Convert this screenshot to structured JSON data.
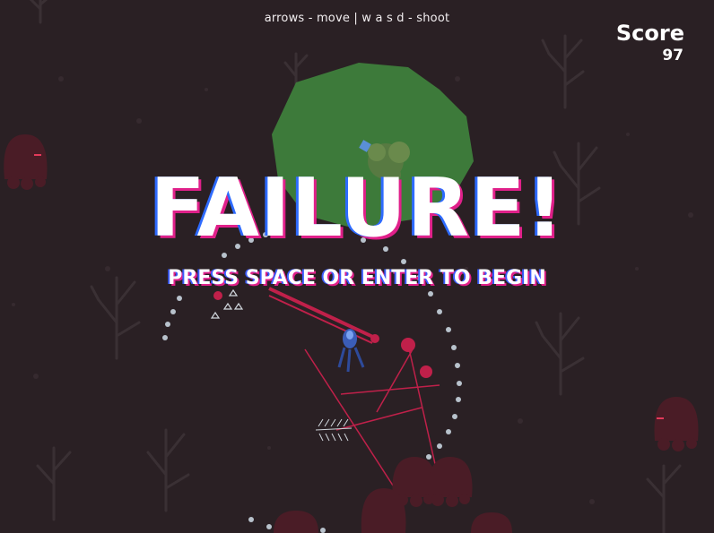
{
  "hud": {
    "controls_hint": "arrows - move | w a s d - shoot",
    "score_label": "Score",
    "score_value": "97"
  },
  "overlay": {
    "title": "FAILURE!",
    "prompt": "PRESS SPACE OR ENTER TO BEGIN"
  },
  "colors": {
    "background": "#2a2024",
    "tree": "#3a3034",
    "enemy_blob": "#4a1c26",
    "enemy_eye": "#e23a5a",
    "green_area": "#3d7a3a",
    "laser": "#c0204a",
    "text_shadow_blue": "#2e6bff",
    "text_shadow_pink": "#e0208a"
  },
  "icons": [
    "dead-tree-icon",
    "enemy-blob-icon",
    "player-character-icon",
    "bush-icon"
  ]
}
